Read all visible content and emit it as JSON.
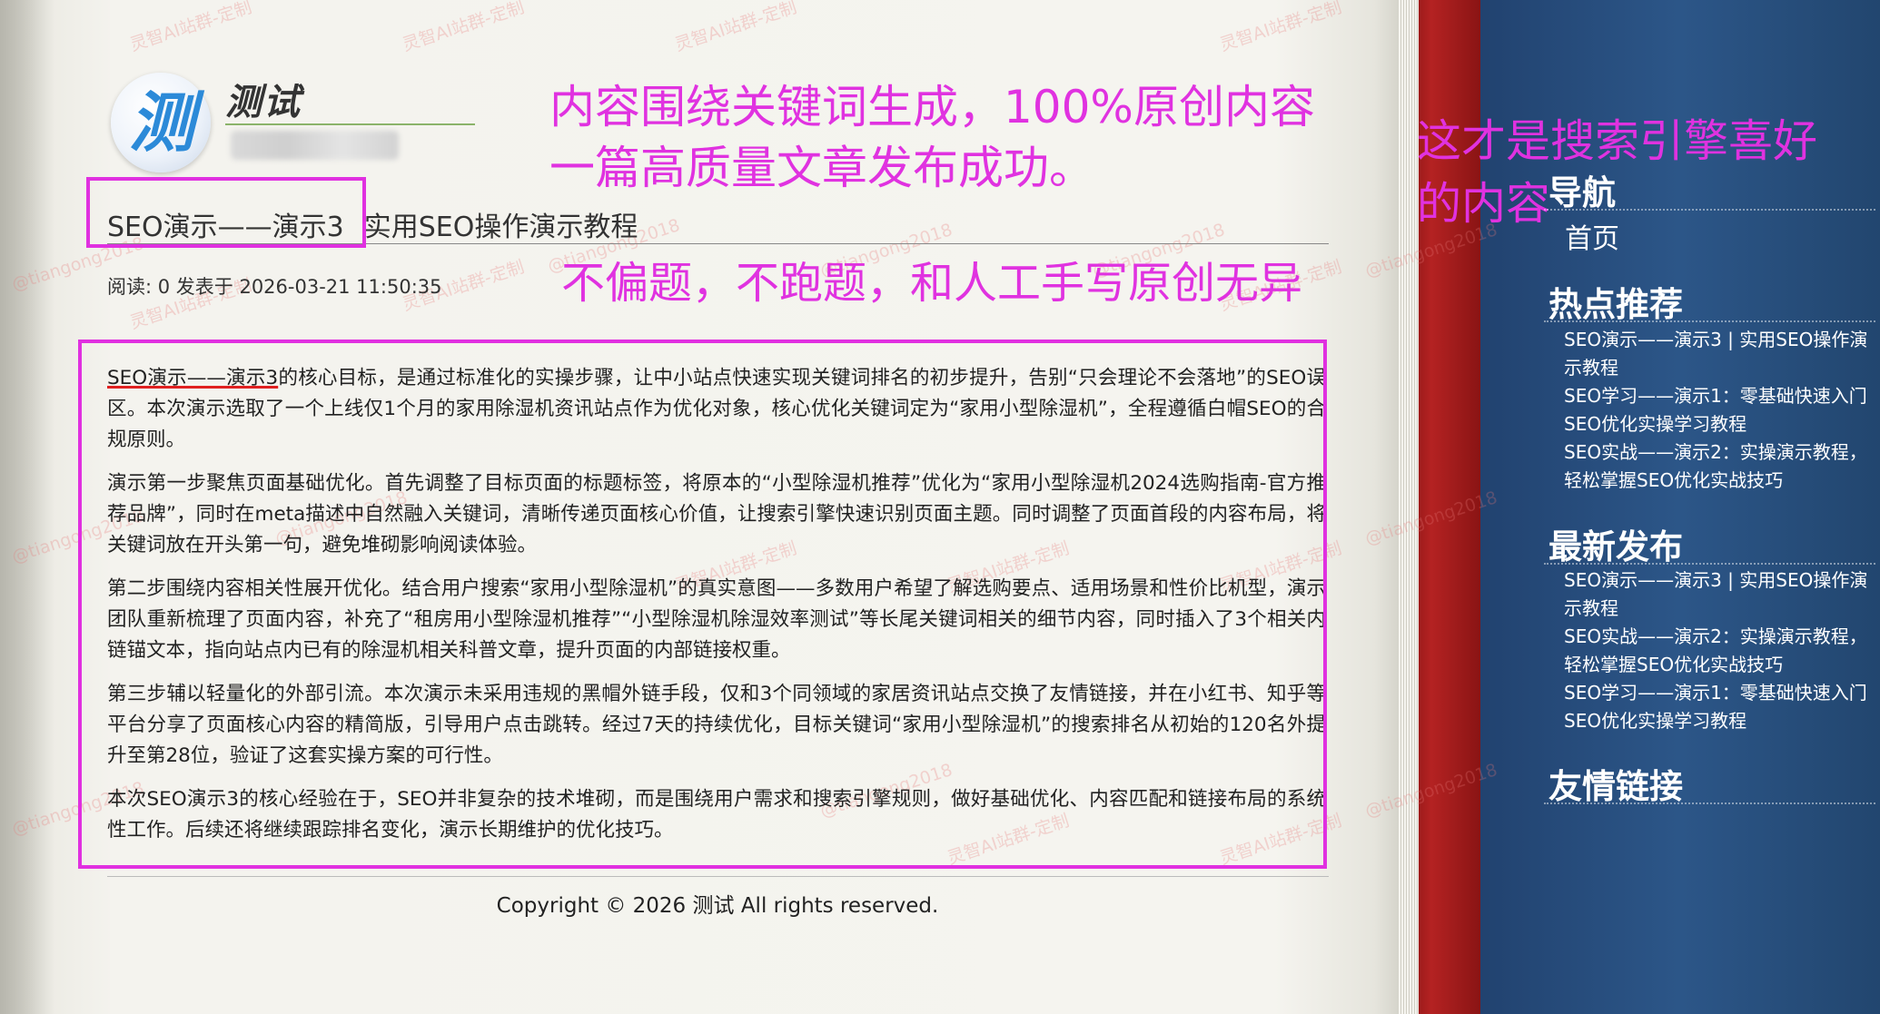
{
  "site": {
    "logo_char": "测",
    "title": "测试"
  },
  "article": {
    "title": "SEO演示——演示3",
    "subtitle": "实用SEO操作演示教程",
    "meta": "阅读: 0 发表于 2026-03-21 11:50:35",
    "p1_underlined": "SEO演示——演示3",
    "p1_rest": "的核心目标，是通过标准化的实操步骤，让中小站点快速实现关键词排名的初步提升，告别“只会理论不会落地”的SEO误区。本次演示选取了一个上线仅1个月的家用除湿机资讯站点作为优化对象，核心优化关键词定为“家用小型除湿机”，全程遵循白帽SEO的合规原则。",
    "p2": "演示第一步聚焦页面基础优化。首先调整了目标页面的标题标签，将原本的“小型除湿机推荐”优化为“家用小型除湿机2024选购指南-官方推荐品牌”，同时在meta描述中自然融入关键词，清晰传递页面核心价值，让搜索引擎快速识别页面主题。同时调整了页面首段的内容布局，将关键词放在开头第一句，避免堆砌影响阅读体验。",
    "p3": "第二步围绕内容相关性展开优化。结合用户搜索“家用小型除湿机”的真实意图——多数用户希望了解选购要点、适用场景和性价比机型，演示团队重新梳理了页面内容，补充了“租房用小型除湿机推荐”“小型除湿机除湿效率测试”等长尾关键词相关的细节内容，同时插入了3个相关内链锚文本，指向站点内已有的除湿机相关科普文章，提升页面的内部链接权重。",
    "p4": "第三步辅以轻量化的外部引流。本次演示未采用违规的黑帽外链手段，仅和3个同领域的家居资讯站点交换了友情链接，并在小红书、知乎等平台分享了页面核心内容的精简版，引导用户点击跳转。经过7天的持续优化，目标关键词“家用小型除湿机”的搜索排名从初始的120名外提升至第28位，验证了这套实操方案的可行性。",
    "p5": "本次SEO演示3的核心经验在于，SEO并非复杂的技术堆砌，而是围绕用户需求和搜索引擎规则，做好基础优化、内容匹配和链接布局的系统性工作。后续还将继续跟踪排名变化，演示长期维护的优化技巧。"
  },
  "footer": {
    "copyright": "Copyright © 2026 测试 All rights reserved."
  },
  "sidebar": {
    "nav_heading": "导航",
    "nav_home": "首页",
    "hot_heading": "热点推荐",
    "hot_items": [
      "SEO演示——演示3 | 实用SEO操作演示教程",
      "SEO学习——演示1：零基础快速入门SEO优化实操学习教程",
      "SEO实战——演示2：实操演示教程，轻松掌握SEO优化实战技巧"
    ],
    "latest_heading": "最新发布",
    "latest_items": [
      "SEO演示——演示3 | 实用SEO操作演示教程",
      "SEO实战——演示2：实操演示教程，轻松掌握SEO优化实战技巧",
      "SEO学习——演示1：零基础快速入门SEO优化实操学习教程"
    ],
    "links_heading": "友情链接"
  },
  "annotations": {
    "line1": "内容围绕关键词生成，100%原创内容",
    "line2": "一篇高质量文章发布成功。",
    "line3": "不偏题，不跑题，和人工手写原创无异",
    "right_line1": "这才是搜索引擎喜好",
    "right_line2": "的内容",
    "color": "#e032e0"
  },
  "watermark": {
    "text_a": "灵智AI站群-定制",
    "text_b": "@tiangong2018",
    "color": "#e67878"
  }
}
